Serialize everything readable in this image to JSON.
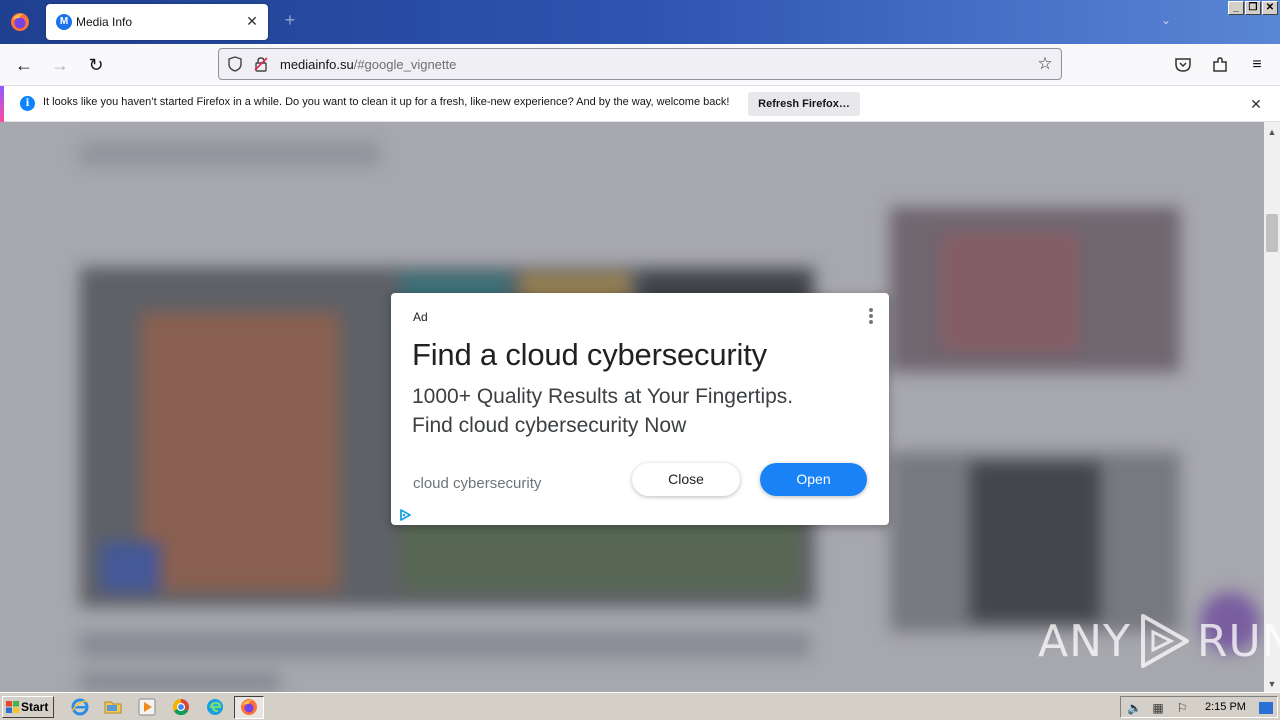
{
  "browser": {
    "tab": {
      "title": "Media Info",
      "favicon_letter": "M"
    },
    "url": {
      "domain": "mediainfo.su",
      "path": "/#google_vignette"
    },
    "notification": {
      "message": "It looks like you haven’t started Firefox in a while. Do you want to clean it up for a fresh, like-new experience? And by the way, welcome back!",
      "button": "Refresh Firefox…"
    }
  },
  "ad": {
    "label": "Ad",
    "headline": "Find a cloud cybersecurity",
    "body_line1": "1000+ Quality Results at Your Fingertips.",
    "body_line2": "Find cloud cybersecurity Now",
    "display_url": "cloud cybersecurity",
    "close_label": "Close",
    "open_label": "Open",
    "open_color": "#1a82f7"
  },
  "watermark": {
    "left": "ANY",
    "right": "RUN"
  },
  "taskbar": {
    "start_label": "Start",
    "clock": "2:15 PM",
    "icons": [
      "ie-icon",
      "folder-icon",
      "media-player-icon",
      "chrome-icon",
      "edge-icon",
      "firefox-icon"
    ]
  }
}
